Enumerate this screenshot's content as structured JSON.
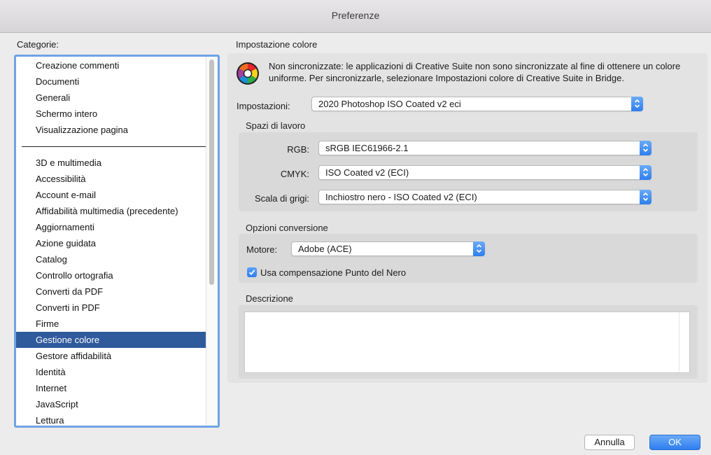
{
  "window": {
    "title": "Preferenze"
  },
  "categories": {
    "label": "Categorie:",
    "group1": [
      "Creazione commenti",
      "Documenti",
      "Generali",
      "Schermo intero",
      "Visualizzazione pagina"
    ],
    "group2": [
      "3D e multimedia",
      "Accessibilità",
      "Account e-mail",
      "Affidabilità multimedia (precedente)",
      "Aggiornamenti",
      "Azione guidata",
      "Catalog",
      "Controllo ortografia",
      "Converti da PDF",
      "Converti in PDF",
      "Firme",
      "Gestione colore",
      "Gestore affidabilità",
      "Identità",
      "Internet",
      "JavaScript",
      "Lettura"
    ],
    "selected": "Gestione colore"
  },
  "color_settings": {
    "section_title": "Impostazione colore",
    "sync_message": "Non sincronizzate: le applicazioni di Creative Suite non sono sincronizzate al fine di ottenere un colore uniforme. Per sincronizzarle, selezionare  Impostazioni colore di Creative Suite in Bridge.",
    "settings_label": "Impostazioni:",
    "settings_value": "2020 Photoshop ISO Coated v2 eci"
  },
  "workspaces": {
    "title": "Spazi di lavoro",
    "rgb_label": "RGB:",
    "rgb_value": "sRGB IEC61966-2.1",
    "cmyk_label": "CMYK:",
    "cmyk_value": "ISO Coated v2 (ECI)",
    "gray_label": "Scala di grigi:",
    "gray_value": "Inchiostro nero - ISO Coated v2 (ECI)"
  },
  "conversion": {
    "title": "Opzioni conversione",
    "engine_label": "Motore:",
    "engine_value": "Adobe (ACE)",
    "blackpoint_label": "Usa compensazione Punto del Nero",
    "blackpoint_checked": true
  },
  "description": {
    "title": "Descrizione",
    "text": ""
  },
  "buttons": {
    "cancel": "Annulla",
    "ok": "OK"
  },
  "colors": {
    "accent": "#2f7ef0",
    "selection": "#2f5a9c",
    "focus_ring": "#6fa3e6"
  }
}
